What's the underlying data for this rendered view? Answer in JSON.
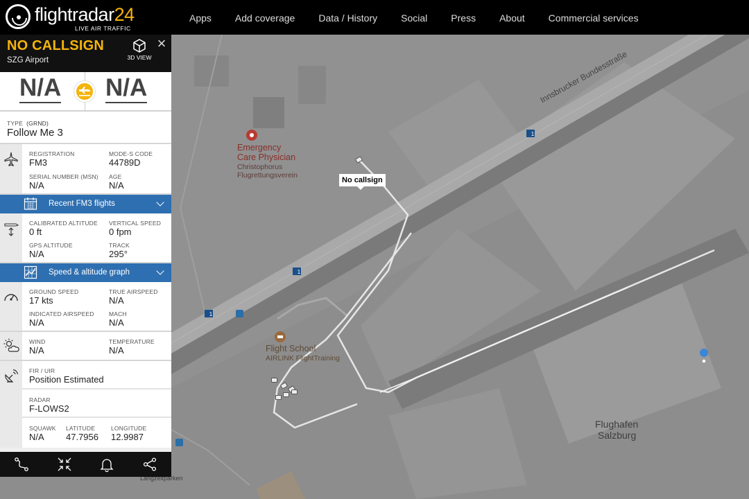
{
  "header": {
    "brand_name": "flightradar",
    "brand_num": "24",
    "brand_tagline": "LIVE AIR TRAFFIC",
    "nav": [
      "Apps",
      "Add coverage",
      "Data / History",
      "Social",
      "Press",
      "About",
      "Commercial services"
    ]
  },
  "panel": {
    "callsign": "NO CALLSIGN",
    "airport": "SZG Airport",
    "view_3d_label": "3D VIEW",
    "origin": "N/A",
    "destination": "N/A",
    "type_label": "TYPE",
    "type_code": "(GRND)",
    "type_value": "Follow Me 3",
    "registration": {
      "label": "REGISTRATION",
      "value": "FM3"
    },
    "modes_code": {
      "label": "MODE-S CODE",
      "value": "44789D"
    },
    "serial_number": {
      "label": "SERIAL NUMBER (MSN)",
      "value": "N/A"
    },
    "age": {
      "label": "AGE",
      "value": "N/A"
    },
    "recent_flights_label": "Recent FM3 flights",
    "calibrated_altitude": {
      "label": "CALIBRATED ALTITUDE",
      "value": "0 ft"
    },
    "vertical_speed": {
      "label": "VERTICAL SPEED",
      "value": "0 fpm"
    },
    "gps_altitude": {
      "label": "GPS ALTITUDE",
      "value": "N/A"
    },
    "track": {
      "label": "TRACK",
      "value": "295°"
    },
    "speed_graph_label": "Speed & altitude graph",
    "ground_speed": {
      "label": "GROUND SPEED",
      "value": "17 kts"
    },
    "true_airspeed": {
      "label": "TRUE AIRSPEED",
      "value": "N/A"
    },
    "indicated_airspeed": {
      "label": "INDICATED AIRSPEED",
      "value": "N/A"
    },
    "mach": {
      "label": "MACH",
      "value": "N/A"
    },
    "wind": {
      "label": "WIND",
      "value": "N/A"
    },
    "temperature": {
      "label": "TEMPERATURE",
      "value": "N/A"
    },
    "fir": {
      "label": "FIR / UIR",
      "value": "Position Estimated"
    },
    "radar": {
      "label": "RADAR",
      "value": "F-LOWS2"
    },
    "squawk": {
      "label": "SQUAWK",
      "value": "N/A"
    },
    "latitude": {
      "label": "LATITUDE",
      "value": "47.7956"
    },
    "longitude": {
      "label": "LONGITUDE",
      "value": "12.9987"
    },
    "toolbar": [
      "route-icon",
      "fullscreen-icon",
      "bell-icon",
      "share-icon"
    ]
  },
  "map": {
    "callsign_tag": "No callsign",
    "road_name": "Innsbrucker Bundesstraße",
    "road_shield": "1",
    "poi_emergency": [
      "Emergency",
      "Care Physician",
      "Christophorus",
      "Flugrettungsverein"
    ],
    "poi_school": [
      "Flight School",
      "AIRLINK FlightTraining"
    ],
    "airport_label": [
      "Flughafen",
      "Salzburg"
    ],
    "parking_label": "Langzeitparken"
  },
  "colors": {
    "accent_yellow": "#f5b40b",
    "bar_blue": "#2e6fb1",
    "map_bg": "#8d8d8d",
    "emergency_red": "#b93a32",
    "school_brown": "#9a6a3c",
    "road_shield_blue": "#1a4f8a",
    "pin_blue": "#3b86d6"
  }
}
